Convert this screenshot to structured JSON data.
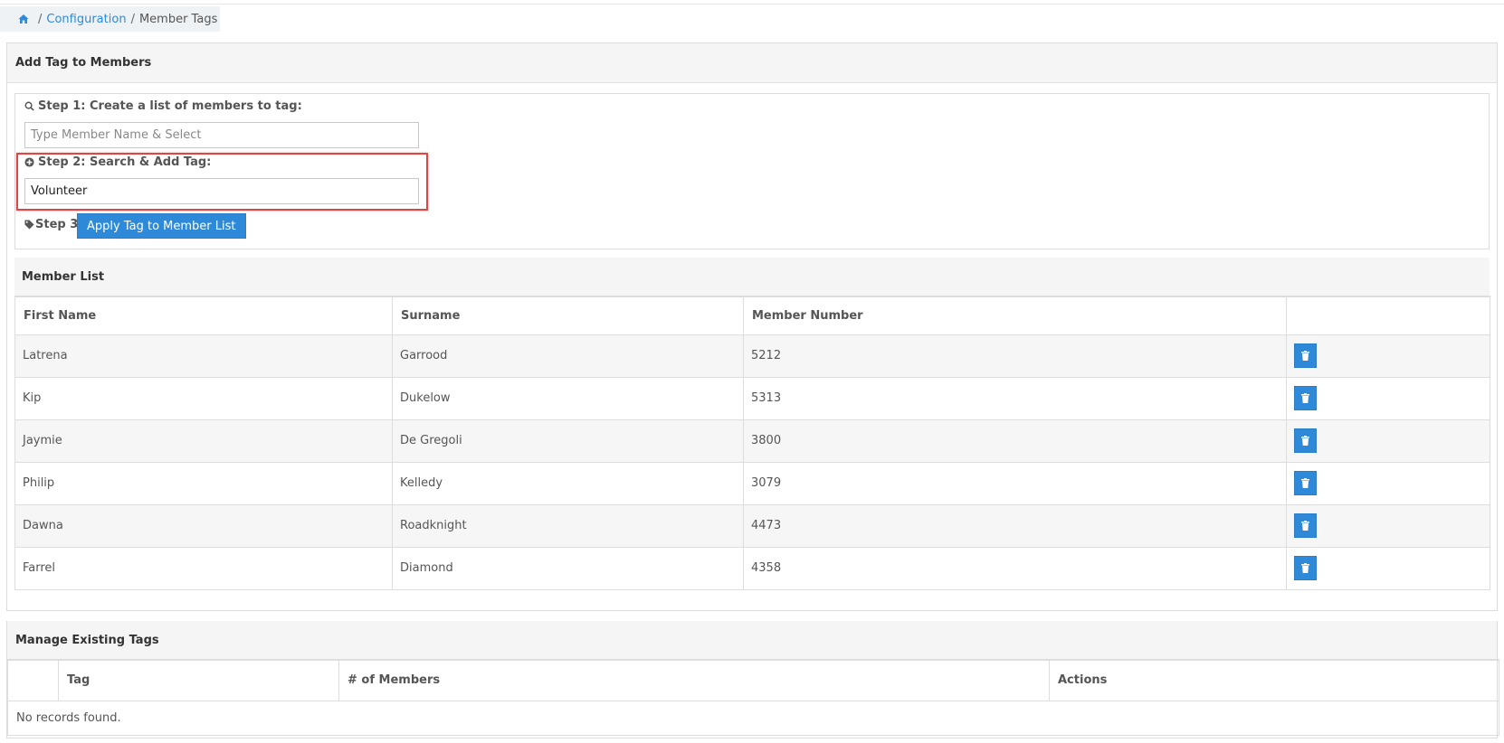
{
  "breadcrumb": {
    "home_icon": "home-icon",
    "separator": "/",
    "configuration": "Configuration",
    "current": "Member Tags"
  },
  "add_panel": {
    "title": "Add Tag to Members",
    "step1_label": "Step 1: Create a list of members to tag:",
    "step1_placeholder": "Type Member Name & Select",
    "step2_label": "Step 2: Search & Add Tag:",
    "step2_value": "Volunteer",
    "step3_label": "Step 3:",
    "apply_button": "Apply Tag to Member List"
  },
  "member_list": {
    "title": "Member List",
    "columns": [
      "First Name",
      "Surname",
      "Member Number",
      ""
    ],
    "rows": [
      {
        "first": "Latrena",
        "surname": "Garrood",
        "number": "5212"
      },
      {
        "first": "Kip",
        "surname": "Dukelow",
        "number": "5313"
      },
      {
        "first": "Jaymie",
        "surname": "De Gregoli",
        "number": "3800"
      },
      {
        "first": "Philip",
        "surname": "Kelledy",
        "number": "3079"
      },
      {
        "first": "Dawna",
        "surname": "Roadknight",
        "number": "4473"
      },
      {
        "first": "Farrel",
        "surname": "Diamond",
        "number": "4358"
      }
    ]
  },
  "manage_panel": {
    "title": "Manage Existing Tags",
    "columns": [
      "",
      "Tag",
      "# of Members",
      "Actions"
    ],
    "empty_text": "No records found."
  },
  "colors": {
    "accent": "#2e8ad8",
    "highlight": "#e04444"
  }
}
